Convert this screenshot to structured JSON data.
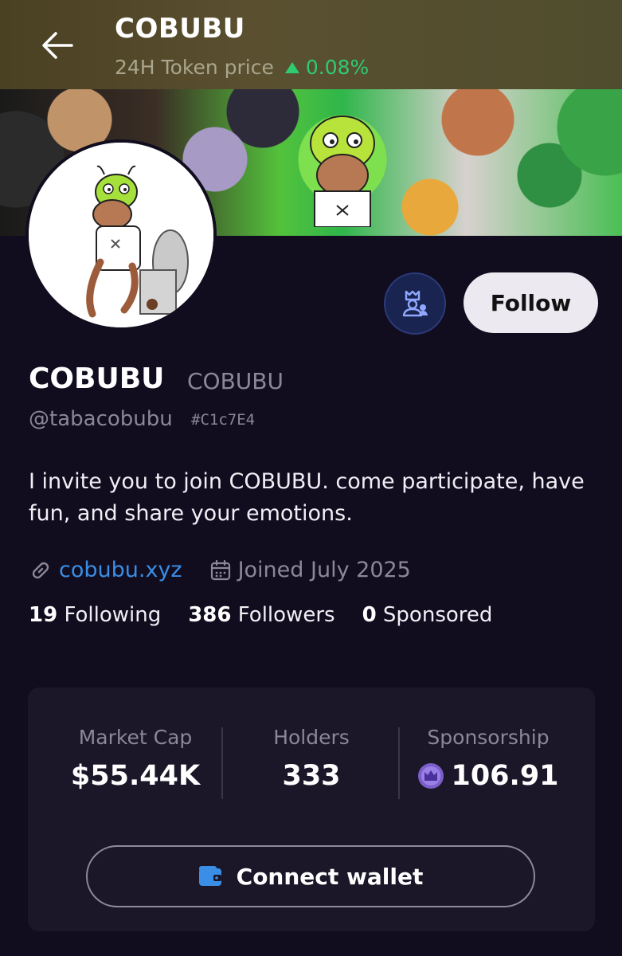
{
  "header": {
    "back_icon": "arrow-left-icon",
    "title": "COBUBU",
    "price_label": "24H Token price",
    "price_change": "0.08%",
    "price_trend_icon": "triangle-up-icon",
    "trend_color": "#2ecc71"
  },
  "profile": {
    "display_name": "COBUBU",
    "ticker": "COBUBU",
    "handle": "@tabacobubu",
    "address": "#C1c7E4",
    "bio": "I invite you to join COBUBU. come participate, have fun, and share your emotions.",
    "website": "cobubu.xyz",
    "joined": "Joined July 2025"
  },
  "actions": {
    "community_icon": "community-icon",
    "follow_label": "Follow"
  },
  "stats": {
    "following_count": "19",
    "following_label": "Following",
    "followers_count": "386",
    "followers_label": "Followers",
    "sponsored_count": "0",
    "sponsored_label": "Sponsored"
  },
  "metrics": {
    "market_cap_label": "Market Cap",
    "market_cap_value": "$55.44K",
    "holders_label": "Holders",
    "holders_value": "333",
    "sponsorship_label": "Sponsorship",
    "sponsorship_value": "106.91",
    "sponsorship_icon": "sponsor-coin-icon"
  },
  "wallet": {
    "connect_label": "Connect wallet",
    "wallet_icon": "wallet-icon",
    "accent": "#3a8ee6"
  }
}
